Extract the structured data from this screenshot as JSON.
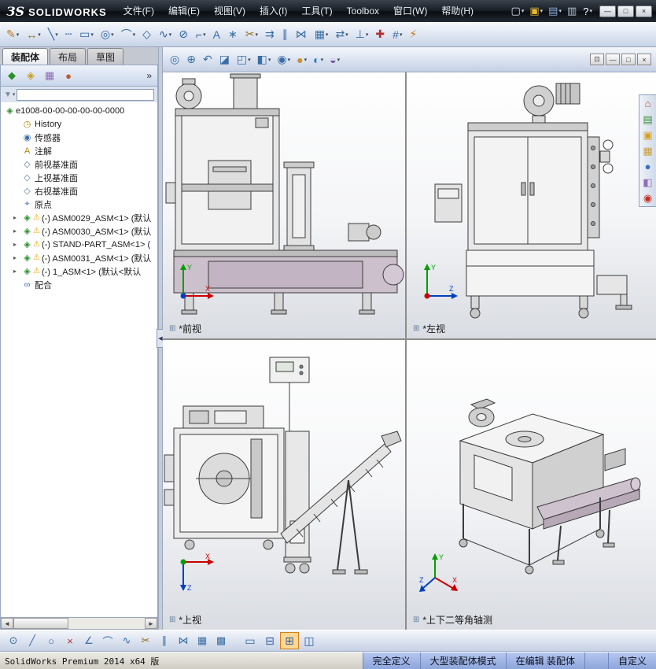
{
  "titlebar": {
    "logo_mark": "ЗS",
    "logo_text": "SOLIDWORKS",
    "menus": [
      {
        "name": "menu-file",
        "label": "文件(F)"
      },
      {
        "name": "menu-edit",
        "label": "编辑(E)"
      },
      {
        "name": "menu-view",
        "label": "视图(V)"
      },
      {
        "name": "menu-insert",
        "label": "插入(I)"
      },
      {
        "name": "menu-tools",
        "label": "工具(T)"
      },
      {
        "name": "menu-toolbox",
        "label": "Toolbox"
      },
      {
        "name": "menu-window",
        "label": "窗口(W)"
      },
      {
        "name": "menu-help",
        "label": "帮助(H)"
      }
    ],
    "quick_icons": [
      {
        "name": "new-document-icon",
        "glyph": "▢",
        "color": "#d8e0f0",
        "arrow": "▾"
      },
      {
        "name": "open-icon",
        "glyph": "▣",
        "color": "#e8b830",
        "arrow": "▾"
      },
      {
        "name": "save-icon",
        "glyph": "▤",
        "color": "#8fb0e0",
        "arrow": "▾"
      },
      {
        "name": "print-icon",
        "glyph": "▥",
        "color": "#b8c2d4",
        "arrow": ""
      },
      {
        "name": "help-icon",
        "glyph": "?",
        "color": "#ffffff",
        "arrow": "▾"
      }
    ],
    "window_buttons": {
      "minimize": "—",
      "maximize": "□",
      "close": "×"
    }
  },
  "top_toolbar": {
    "items": [
      {
        "name": "sketch-icon",
        "glyph": "✎",
        "color": "#c07818",
        "arrow": "▾"
      },
      {
        "name": "smart-dimension-icon",
        "glyph": "↔",
        "color": "#8a6d1a",
        "arrow": "▾"
      },
      {
        "name": "line-icon",
        "glyph": "╲",
        "color": "#2a5fa0",
        "arrow": "▾"
      },
      {
        "name": "centerline-icon",
        "glyph": "┄",
        "color": "#2a5fa0",
        "arrow": ""
      },
      {
        "name": "rectangle-icon",
        "glyph": "▭",
        "color": "#2a5fa0",
        "arrow": "▾"
      },
      {
        "name": "circle-icon",
        "glyph": "◎",
        "color": "#2a5fa0",
        "arrow": "▾"
      },
      {
        "name": "arc-icon",
        "glyph": "⌒",
        "color": "#2a5fa0",
        "arrow": "▾"
      },
      {
        "name": "polygon-icon",
        "glyph": "◇",
        "color": "#2a5fa0",
        "arrow": ""
      },
      {
        "name": "spline-icon",
        "glyph": "∿",
        "color": "#2a5fa0",
        "arrow": "▾"
      },
      {
        "name": "ellipse-icon",
        "glyph": "⊘",
        "color": "#2a5fa0",
        "arrow": ""
      },
      {
        "name": "fillet-icon",
        "glyph": "⌐",
        "color": "#2a5fa0",
        "arrow": "▾"
      },
      {
        "name": "text-icon",
        "glyph": "A",
        "color": "#3a6ea5",
        "arrow": ""
      },
      {
        "name": "point-icon",
        "glyph": "∗",
        "color": "#3a6ea5",
        "arrow": ""
      },
      {
        "name": "trim-entities-icon",
        "glyph": "✂",
        "color": "#8a6d1a",
        "arrow": "▾"
      },
      {
        "name": "convert-entities-icon",
        "glyph": "⇉",
        "color": "#3a6ea5",
        "arrow": ""
      },
      {
        "name": "offset-entities-icon",
        "glyph": "∥",
        "color": "#3a6ea5",
        "arrow": ""
      },
      {
        "name": "mirror-entities-icon",
        "glyph": "⋈",
        "color": "#3a6ea5",
        "arrow": ""
      },
      {
        "name": "linear-pattern-icon",
        "glyph": "▦",
        "color": "#3a6ea5",
        "arrow": "▾"
      },
      {
        "name": "move-entities-icon",
        "glyph": "⇄",
        "color": "#3a6ea5",
        "arrow": "▾"
      },
      {
        "name": "display-relations-icon",
        "glyph": "⊥",
        "color": "#3a6ea5",
        "arrow": "▾"
      },
      {
        "name": "repair-sketch-icon",
        "glyph": "✚",
        "color": "#b03030",
        "arrow": ""
      },
      {
        "name": "quick-snaps-icon",
        "glyph": "#",
        "color": "#3a6ea5",
        "arrow": "▾"
      },
      {
        "name": "rapid-sketch-icon",
        "glyph": "⚡",
        "color": "#c07818",
        "arrow": ""
      }
    ]
  },
  "left_panel": {
    "tabs": {
      "assembly": "装配体",
      "layout": "布局",
      "sketch": "草图"
    },
    "manager_tabs": [
      {
        "name": "featuremanager-tab-icon",
        "glyph": "◆",
        "color": "#2a8f2a"
      },
      {
        "name": "propertymanager-tab-icon",
        "glyph": "◈",
        "color": "#c8a020"
      },
      {
        "name": "configurationmanager-tab-icon",
        "glyph": "▦",
        "color": "#8f6db5"
      },
      {
        "name": "displaymanager-tab-icon",
        "glyph": "●",
        "color": "#c05830"
      }
    ],
    "overflow_chevron": "»",
    "filter": {
      "funnel_glyph": "▼",
      "arrow": "▾"
    },
    "splitter_arrow": "◀",
    "scrollbar": {
      "left_arrow": "◄",
      "right_arrow": "►"
    }
  },
  "tree": {
    "root": {
      "glyph": "◈",
      "color": "#2a8f2a",
      "label": "e1008-00-00-00-00-00-0000"
    },
    "items": [
      {
        "name": "tree-item-history",
        "expand": "",
        "glyph": "◷",
        "gcolor": "#b8860b",
        "warn": "",
        "label": "History"
      },
      {
        "name": "tree-item-sensors",
        "expand": "",
        "glyph": "◉",
        "gcolor": "#3a6ea5",
        "warn": "",
        "label": "传感器"
      },
      {
        "name": "tree-item-annotations",
        "expand": "",
        "glyph": "A",
        "gcolor": "#b8860b",
        "warn": "",
        "label": "注解"
      },
      {
        "name": "tree-item-front-plane",
        "expand": "",
        "glyph": "◇",
        "gcolor": "#5a7a9a",
        "warn": "",
        "label": "前视基准面"
      },
      {
        "name": "tree-item-top-plane",
        "expand": "",
        "glyph": "◇",
        "gcolor": "#5a7a9a",
        "warn": "",
        "label": "上视基准面"
      },
      {
        "name": "tree-item-right-plane",
        "expand": "",
        "glyph": "◇",
        "gcolor": "#5a7a9a",
        "warn": "",
        "label": "右视基准面"
      },
      {
        "name": "tree-item-origin",
        "expand": "",
        "glyph": "⌖",
        "gcolor": "#3a6ea5",
        "warn": "",
        "label": "原点"
      },
      {
        "name": "tree-item-asm0029",
        "expand": "▸",
        "glyph": "◈",
        "gcolor": "#2a8f2a",
        "warn": "⚠",
        "label": "(-) ASM0029_ASM<1> (默认"
      },
      {
        "name": "tree-item-asm0030",
        "expand": "▸",
        "glyph": "◈",
        "gcolor": "#2a8f2a",
        "warn": "⚠",
        "label": "(-) ASM0030_ASM<1> (默认"
      },
      {
        "name": "tree-item-stand-part",
        "expand": "▸",
        "glyph": "◈",
        "gcolor": "#2a8f2a",
        "warn": "⚠",
        "label": "(-) STAND-PART_ASM<1> ("
      },
      {
        "name": "tree-item-asm0031",
        "expand": "▸",
        "glyph": "◈",
        "gcolor": "#2a8f2a",
        "warn": "⚠",
        "label": "(-) ASM0031_ASM<1> (默认"
      },
      {
        "name": "tree-item-1-asm",
        "expand": "▸",
        "glyph": "◈",
        "gcolor": "#2a8f2a",
        "warn": "⚠",
        "label": "(-) 1_ASM<1> (默认<默认"
      },
      {
        "name": "tree-item-mates",
        "expand": "",
        "glyph": "∞",
        "gcolor": "#3a6ea5",
        "warn": "",
        "label": "配合"
      }
    ]
  },
  "viewport": {
    "toolbar": [
      {
        "name": "zoom-fit-icon",
        "glyph": "◎",
        "color": "#3a6ea5",
        "arrow": ""
      },
      {
        "name": "zoom-area-icon",
        "glyph": "⊕",
        "color": "#3a6ea5",
        "arrow": ""
      },
      {
        "name": "previous-view-icon",
        "glyph": "↶",
        "color": "#3a6ea5",
        "arrow": ""
      },
      {
        "name": "section-view-icon",
        "glyph": "◪",
        "color": "#3a6ea5",
        "arrow": ""
      },
      {
        "name": "view-orientation-icon",
        "glyph": "◰",
        "color": "#3a6ea5",
        "arrow": "▾"
      },
      {
        "name": "display-style-icon",
        "glyph": "◧",
        "color": "#3a6ea5",
        "arrow": "▾"
      },
      {
        "name": "hide-show-items-icon",
        "glyph": "◉",
        "color": "#3a6ea5",
        "arrow": "▾"
      },
      {
        "name": "edit-appearance-icon",
        "glyph": "●",
        "color": "#c89030",
        "arrow": "▾"
      },
      {
        "name": "apply-scene-icon",
        "glyph": "◐",
        "color": "#2a7fbf",
        "arrow": "▾"
      },
      {
        "name": "view-settings-icon",
        "glyph": "◒",
        "color": "#7a4fa0",
        "arrow": "▾"
      }
    ],
    "window_buttons": [
      {
        "name": "doc-collapse-button",
        "glyph": "⊡"
      },
      {
        "name": "doc-minimize-button",
        "glyph": "—"
      },
      {
        "name": "doc-restore-button",
        "glyph": "□"
      },
      {
        "name": "doc-close-button",
        "glyph": "×"
      }
    ],
    "views": {
      "front": {
        "label": "*前视"
      },
      "left": {
        "label": "*左视"
      },
      "top": {
        "label": "*上视"
      },
      "iso": {
        "label": "*上下二等角轴测"
      }
    },
    "view_icon_glyph": "⊞",
    "axis": {
      "x": "X",
      "y": "Y",
      "z": "Z"
    }
  },
  "task_pane": [
    {
      "name": "home-icon",
      "glyph": "⌂",
      "color": "#c05020"
    },
    {
      "name": "design-library-icon",
      "glyph": "▤",
      "color": "#3a8f3a"
    },
    {
      "name": "file-explorer-icon",
      "glyph": "▣",
      "color": "#d8a020"
    },
    {
      "name": "view-palette-icon",
      "glyph": "▦",
      "color": "#c8a040"
    },
    {
      "name": "appearances-icon",
      "glyph": "●",
      "color": "#3a6ec0"
    },
    {
      "name": "scenes-icon",
      "glyph": "◧",
      "color": "#8f6db5"
    },
    {
      "name": "forum-icon",
      "glyph": "◉",
      "color": "#c03020"
    }
  ],
  "bottom_toolbar": {
    "items": [
      {
        "name": "select-filter-icon",
        "glyph": "⊙",
        "color": "#3a6ea5"
      },
      {
        "name": "line-icon",
        "glyph": "╱",
        "color": "#3a6ea5"
      },
      {
        "name": "circle-icon",
        "glyph": "○",
        "color": "#3a6ea5"
      },
      {
        "name": "erase-icon",
        "glyph": "×",
        "color": "#b03030"
      },
      {
        "name": "perpendicular-icon",
        "glyph": "∠",
        "color": "#3a6ea5"
      },
      {
        "name": "arc-icon",
        "glyph": "⌒",
        "color": "#3a6ea5"
      },
      {
        "name": "spline-icon",
        "glyph": "∿",
        "color": "#3a6ea5"
      },
      {
        "name": "trim-icon",
        "glyph": "✂",
        "color": "#8a6d1a"
      },
      {
        "name": "offset-icon",
        "glyph": "∥",
        "color": "#3a6ea5"
      },
      {
        "name": "mirror-icon",
        "glyph": "⋈",
        "color": "#3a6ea5"
      },
      {
        "name": "pattern-icon",
        "glyph": "▦",
        "color": "#3a6ea5"
      },
      {
        "name": "snap-grid-icon",
        "glyph": "▩",
        "color": "#3a6ea5"
      }
    ],
    "layout_buttons": {
      "single": {
        "glyph": "▭"
      },
      "two": {
        "glyph": "⊟"
      },
      "four": {
        "glyph": "⊞"
      },
      "link": {
        "glyph": "◫"
      }
    }
  },
  "statusbar": {
    "app_info": "SolidWorks Premium 2014 x64 版",
    "define_state": "完全定义",
    "mode": "大型装配体模式",
    "editing": "在编辑 装配体",
    "custom": "自定义"
  }
}
